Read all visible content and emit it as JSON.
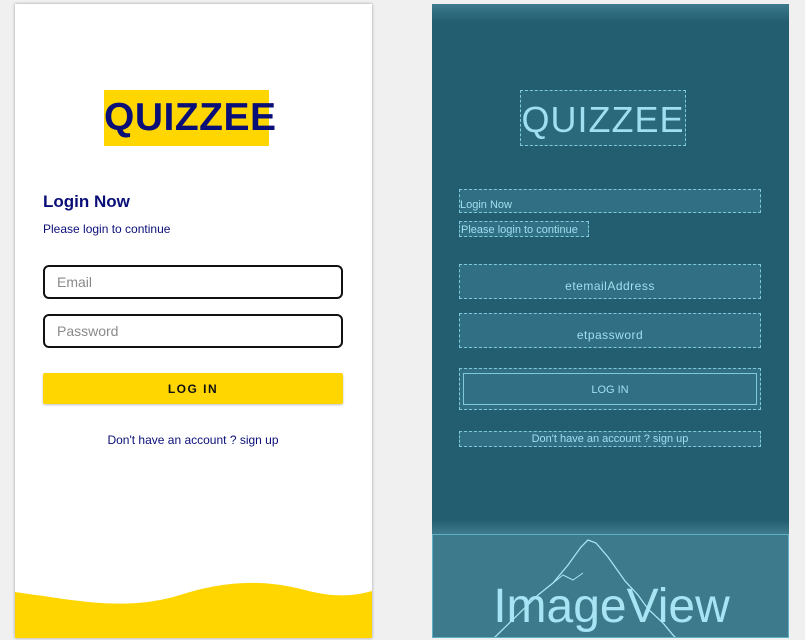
{
  "design": {
    "logo_text": "QUIZZEE",
    "title": "Login Now",
    "subtitle": "Please login to continue",
    "email_placeholder": "Email",
    "password_placeholder": "Password",
    "login_button": "LOG IN",
    "signup_text": "Don't have an account ? sign up"
  },
  "blueprint": {
    "logo_text": "QUIZZEE",
    "title": "Login Now",
    "subtitle": "Please login to continue",
    "email_id": "etemailAddress",
    "password_id": "etpassword",
    "login_button": "LOG IN",
    "signup_text": "Don't have an account ? sign up",
    "image_label": "ImageView"
  },
  "colors": {
    "accent_yellow": "#FFD600",
    "brand_navy": "#0a0f78",
    "blueprint_bg": "#225d70"
  }
}
